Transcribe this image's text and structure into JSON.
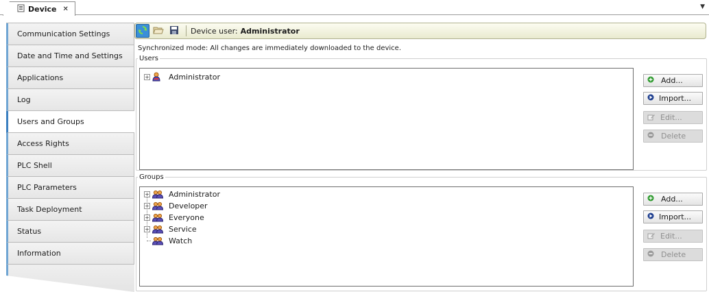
{
  "tab": {
    "label": "Device",
    "close": "✕",
    "dropdown": "▼"
  },
  "nav": {
    "items": [
      {
        "label": "Communication Settings"
      },
      {
        "label": "Date and Time and Settings"
      },
      {
        "label": "Applications"
      },
      {
        "label": "Log"
      },
      {
        "label": "Users and Groups"
      },
      {
        "label": "Access Rights"
      },
      {
        "label": "PLC Shell"
      },
      {
        "label": "PLC Parameters"
      },
      {
        "label": "Task Deployment"
      },
      {
        "label": "Status"
      },
      {
        "label": "Information"
      }
    ],
    "active": "Users and Groups"
  },
  "toolbar": {
    "device_user_label": "Device user:",
    "device_user_value": "Administrator"
  },
  "sync_message": "Synchronized mode: All changes are immediately downloaded to the device.",
  "users": {
    "legend": "Users",
    "items": [
      {
        "label": "Administrator",
        "expandable": true
      }
    ],
    "buttons": {
      "add": "Add...",
      "import": "Import...",
      "edit": "Edit...",
      "delete": "Delete"
    }
  },
  "groups": {
    "legend": "Groups",
    "items": [
      {
        "label": "Administrator",
        "expandable": true
      },
      {
        "label": "Developer",
        "expandable": true
      },
      {
        "label": "Everyone",
        "expandable": true
      },
      {
        "label": "Service",
        "expandable": true
      },
      {
        "label": "Watch",
        "expandable": false
      }
    ],
    "buttons": {
      "add": "Add...",
      "import": "Import...",
      "edit": "Edit...",
      "delete": "Delete"
    }
  },
  "colors": {
    "accent": "#3a7fc0",
    "toolbar": "#e9eacf",
    "add": "#2e9a2e",
    "import": "#1f3f8f"
  }
}
